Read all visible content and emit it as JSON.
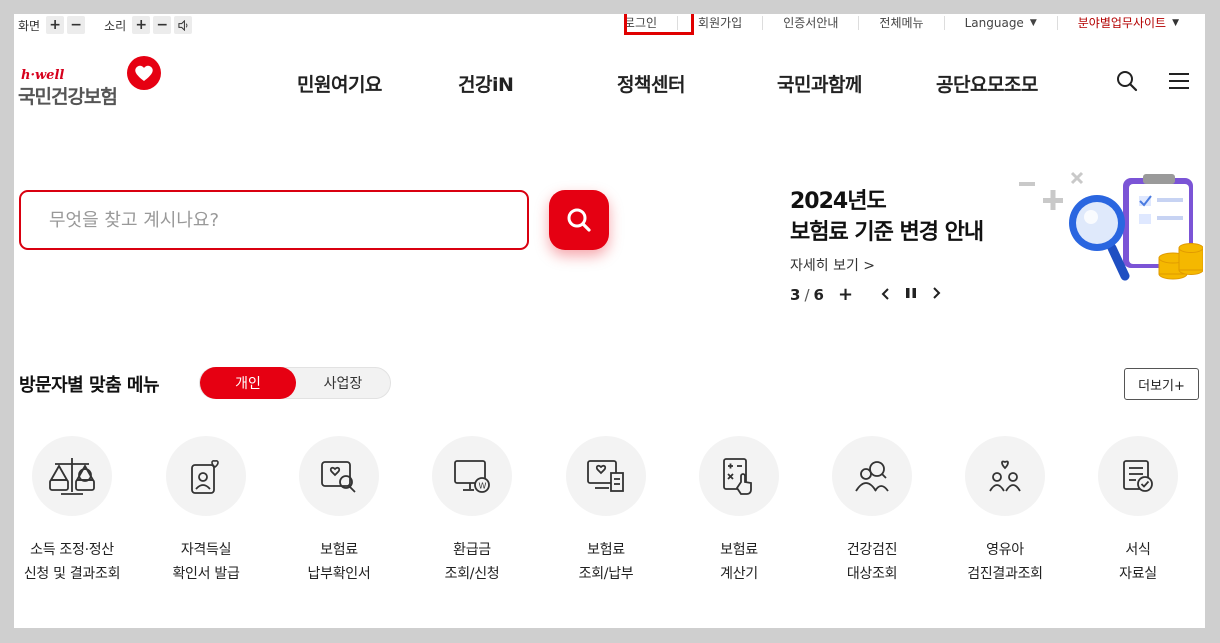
{
  "util_left": {
    "screen_label": "화면",
    "sound_label": "소리",
    "plus": "+",
    "minus": "−"
  },
  "util_right": {
    "login": "로그인",
    "signup": "회원가입",
    "cert": "인증서안내",
    "allmenu": "전체메뉴",
    "language": "Language",
    "field_sites": "분야별업무사이트"
  },
  "logo": {
    "tagline": "h·well",
    "name": "국민건강보험"
  },
  "nav": [
    "민원여기요",
    "건강iN",
    "정책센터",
    "국민과함께",
    "공단요모조모"
  ],
  "search": {
    "placeholder": "무엇을 찾고 계시나요?"
  },
  "banner": {
    "title_line1": "2024년도",
    "title_line2": "보험료 기준 변경 안내",
    "more": "자세히 보기 >",
    "current": "3",
    "slash": "/",
    "total": "6"
  },
  "visitor": {
    "title": "방문자별 맞춤 메뉴",
    "tab_personal": "개인",
    "tab_business": "사업장",
    "more": "더보기+"
  },
  "menu_items": [
    {
      "icon": "scale-icon",
      "l1": "소득 조정·정산",
      "l2": "신청 및 결과조회"
    },
    {
      "icon": "id-card-heart-icon",
      "l1": "자격득실",
      "l2": "확인서 발급"
    },
    {
      "icon": "payment-search-icon",
      "l1": "보험료",
      "l2": "납부확인서"
    },
    {
      "icon": "refund-monitor-icon",
      "l1": "환급금",
      "l2": "조회/신청"
    },
    {
      "icon": "premium-receipt-icon",
      "l1": "보험료",
      "l2": "조회/납부"
    },
    {
      "icon": "calculator-icon",
      "l1": "보험료",
      "l2": "계산기"
    },
    {
      "icon": "health-checkup-icon",
      "l1": "건강검진",
      "l2": "대상조회"
    },
    {
      "icon": "infant-checkup-icon",
      "l1": "영유아",
      "l2": "검진결과조회"
    },
    {
      "icon": "document-form-icon",
      "l1": "서식",
      "l2": "자료실"
    }
  ],
  "colors": {
    "brand_red": "#e60012",
    "login_highlight": "#e00000"
  }
}
